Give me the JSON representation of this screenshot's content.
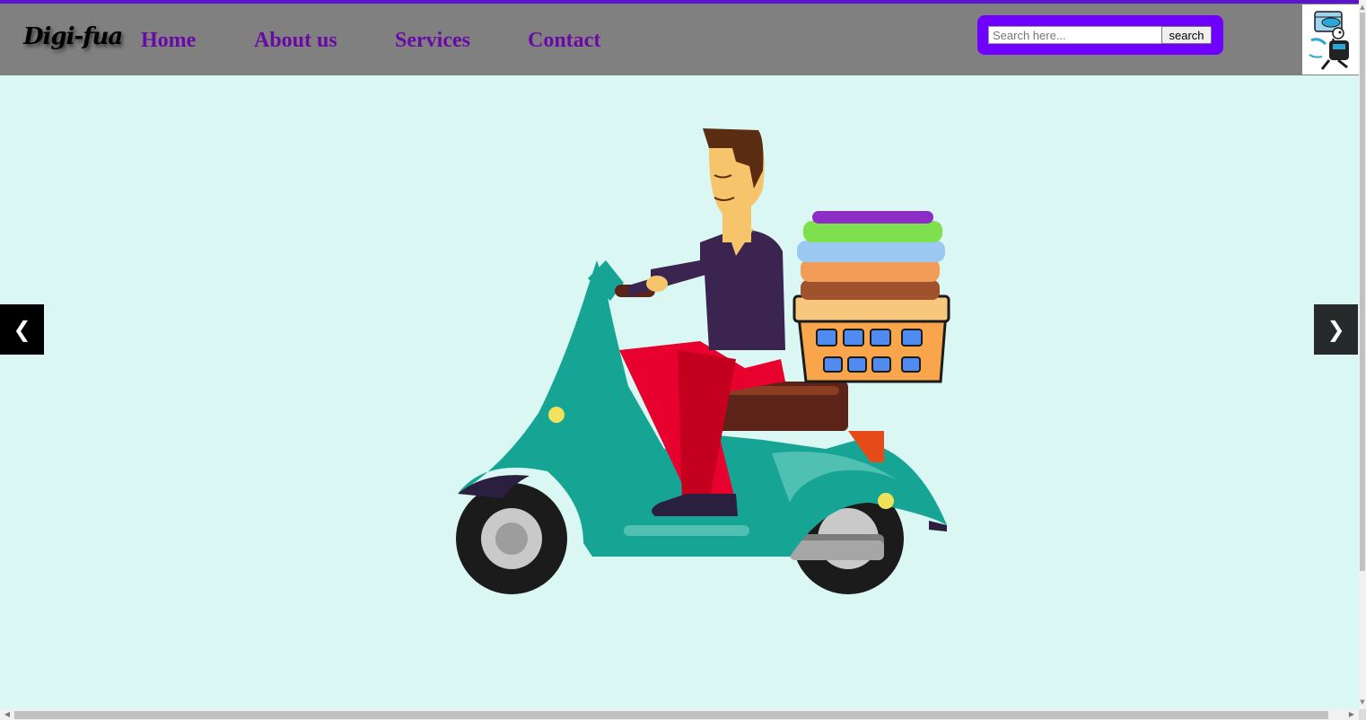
{
  "brand": {
    "logo_text": "Digi-fua",
    "accent_color": "#5b16c9",
    "nav_color": "#6a0aa6",
    "search_bg": "#6f00ff"
  },
  "nav": {
    "items": [
      {
        "label": "Home"
      },
      {
        "label": "About us"
      },
      {
        "label": "Services"
      },
      {
        "label": "Contact"
      }
    ]
  },
  "search": {
    "placeholder": "Search here...",
    "button_label": "search"
  },
  "slider": {
    "prev_label": "❮",
    "next_label": "❯",
    "image_icon": "laundry-delivery-scooter-illustration"
  },
  "avatar": {
    "icon": "laundry-delivery-man-icon"
  }
}
